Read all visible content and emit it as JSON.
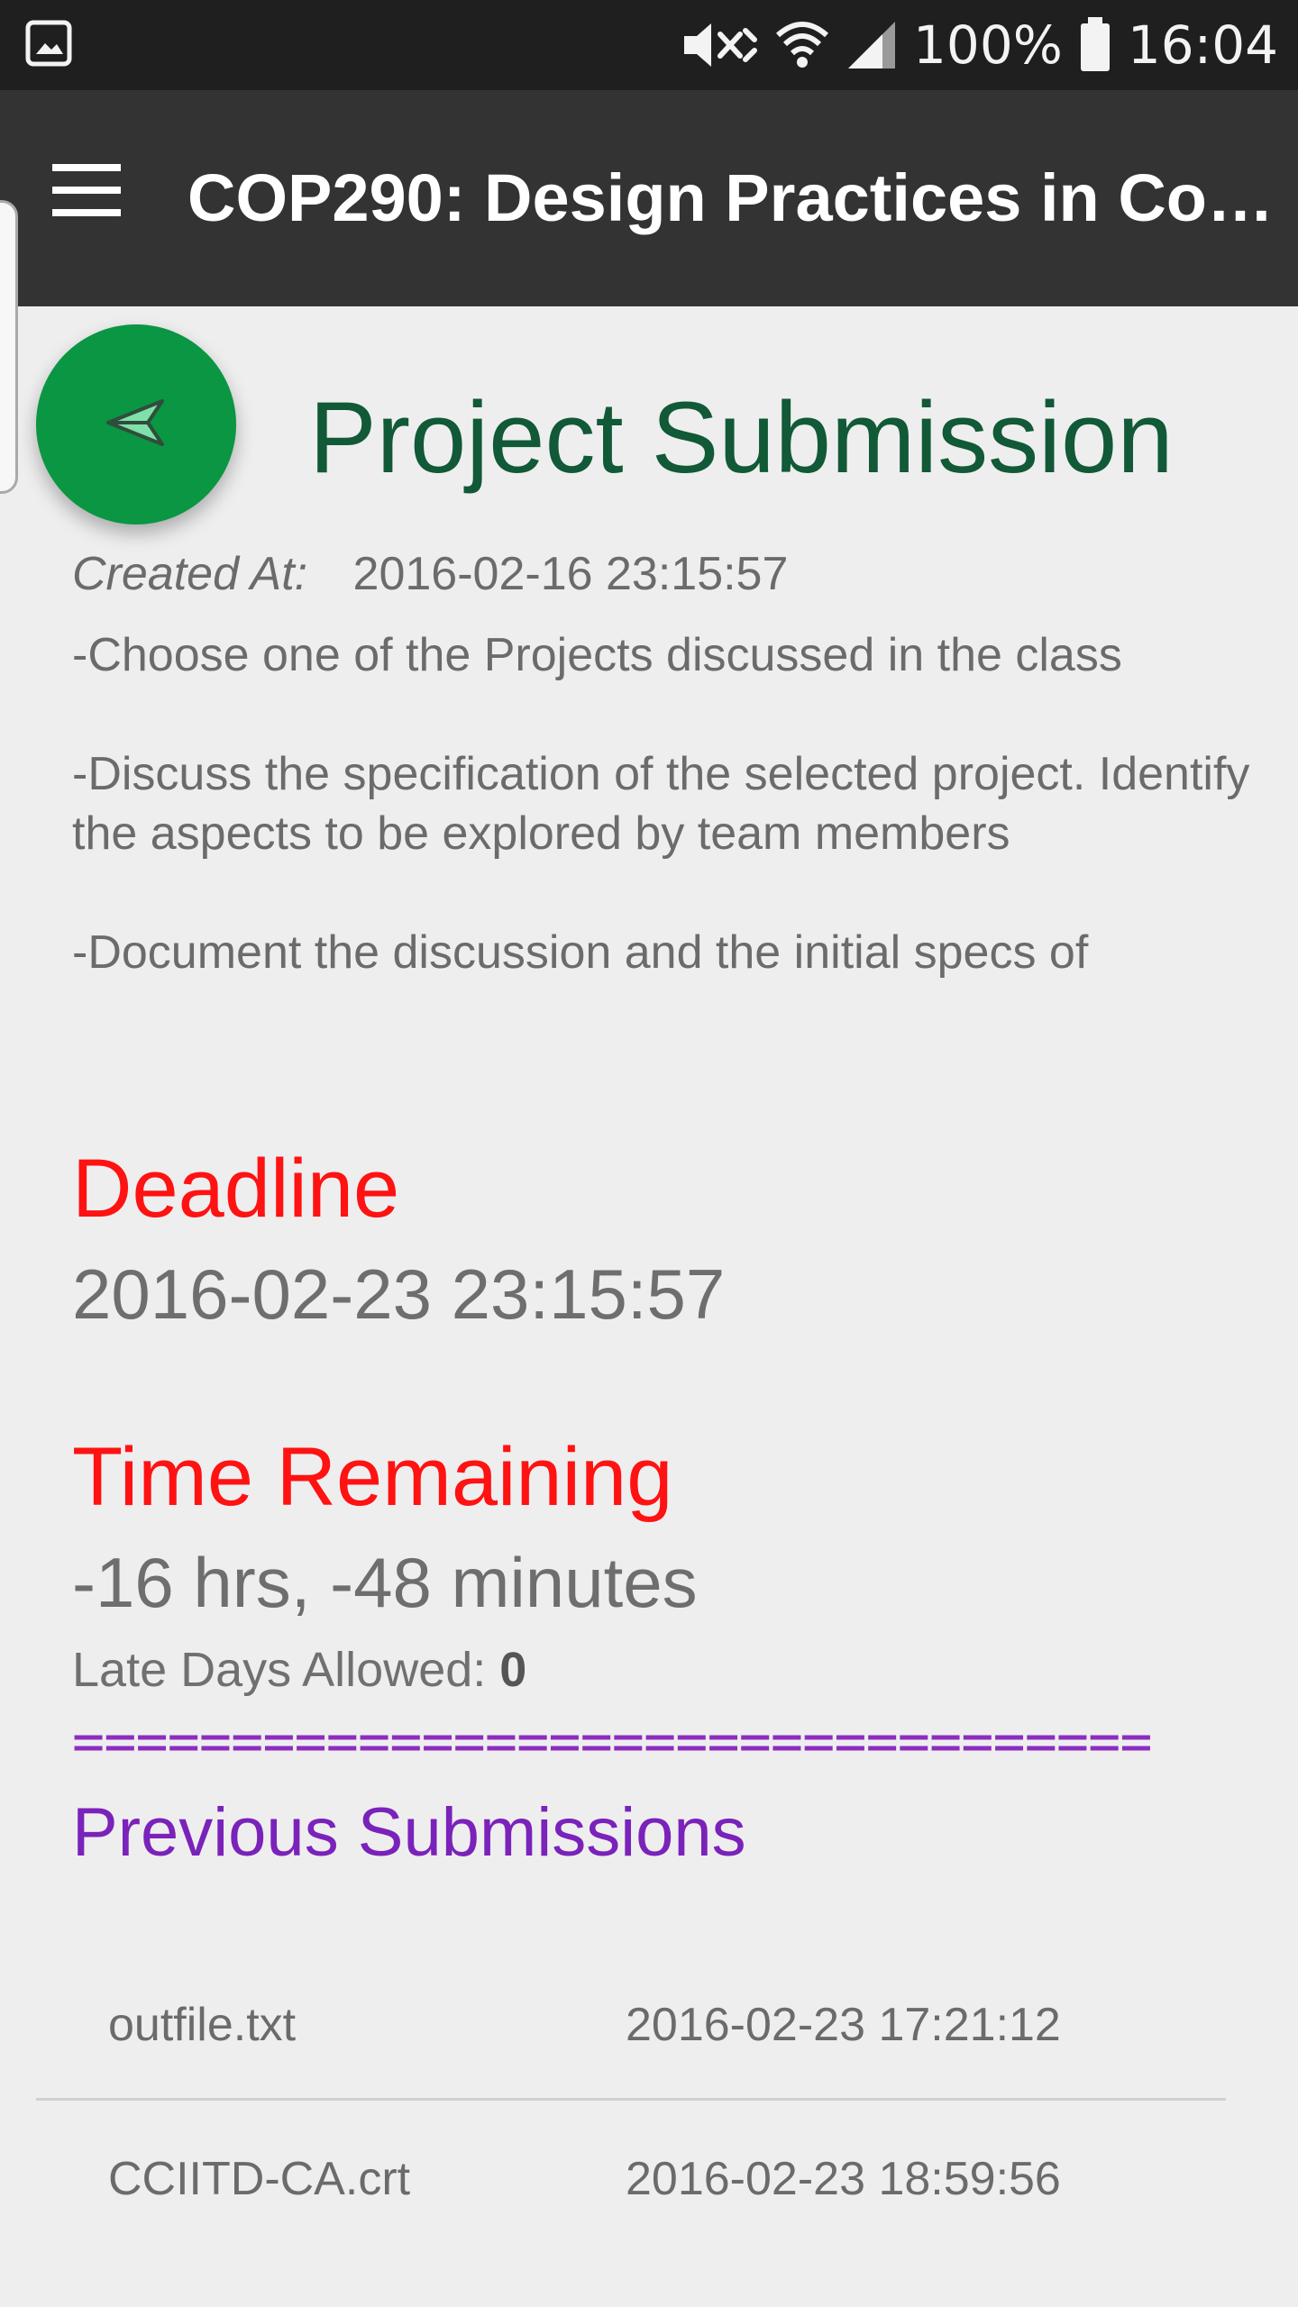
{
  "status_bar": {
    "battery": "100%",
    "time": "16:04",
    "icons": [
      "image-icon",
      "mute-icon",
      "wifi-icon",
      "signal-icon",
      "battery-icon"
    ]
  },
  "app_bar": {
    "title": "COP290: Design Practices in Co…",
    "menu_icon": "menu-icon"
  },
  "fab": {
    "icon": "send-icon",
    "color": "#0a9642"
  },
  "assignment": {
    "title": "Project Submission",
    "created_label": "Created At:",
    "created_value": "2016-02-16 23:15:57",
    "description": [
      "-Choose one of the Projects discussed in the class",
      "-Discuss the specification of the selected project. Identify the aspects to be explored by team members",
      "-Document the discussion and the initial specs of"
    ],
    "deadline_label": "Deadline",
    "deadline_value": "2016-02-23 23:15:57",
    "time_remaining_label": "Time Remaining",
    "time_remaining_value": "-16 hrs, -48 minutes",
    "late_days_label": "Late Days Allowed:",
    "late_days_value": "0",
    "divider": "==================================",
    "previous_heading": "Previous Submissions"
  },
  "submissions": [
    {
      "file": "outfile.txt",
      "time": "2016-02-23 17:21:12"
    },
    {
      "file": "CCIITD-CA.crt",
      "time": "2016-02-23 18:59:56"
    }
  ],
  "colors": {
    "app_bar": "#333333",
    "heading_green": "#115937",
    "deadline_red": "#ff1212",
    "previous_purple": "#7a22ba"
  }
}
